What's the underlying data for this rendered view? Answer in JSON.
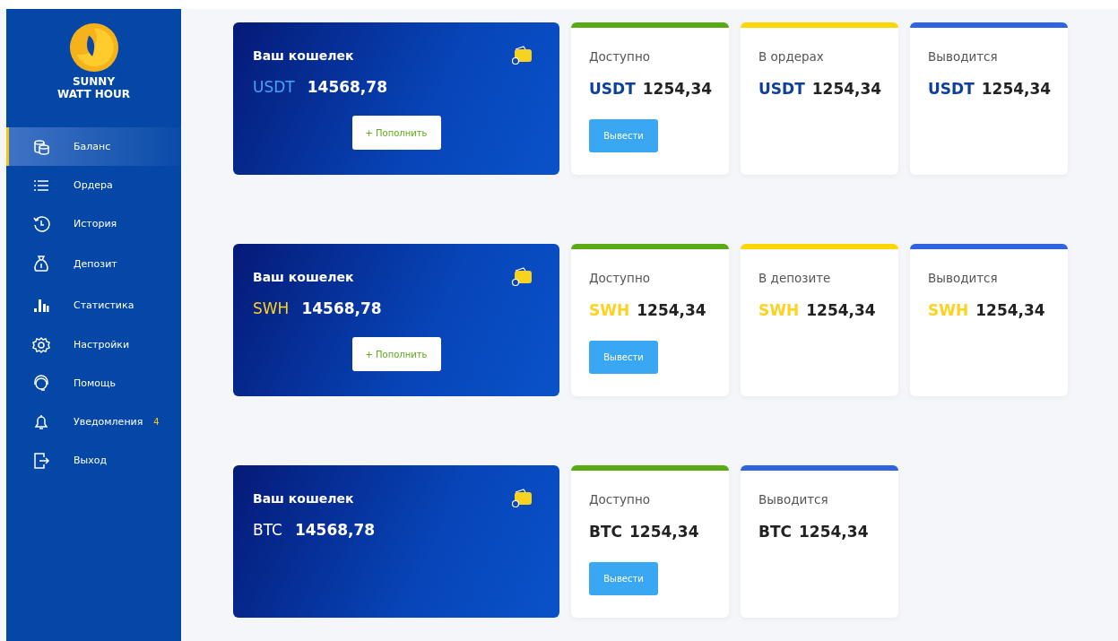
{
  "brand": {
    "line1": "SUNNY",
    "line2": "WATT HOUR"
  },
  "sidebar": {
    "items": [
      {
        "label": "Баланс",
        "selected": true
      },
      {
        "label": "Ордера",
        "selected": false
      },
      {
        "label": "История",
        "selected": false
      },
      {
        "label": "Депозит",
        "selected": false
      },
      {
        "label": "Статистика",
        "selected": false
      },
      {
        "label": "Настройки",
        "selected": false
      },
      {
        "label": "Помощь",
        "selected": false
      },
      {
        "label": "Уведомления",
        "selected": false,
        "badge": "4"
      },
      {
        "label": "Выход",
        "selected": false
      }
    ]
  },
  "sections": [
    {
      "wallet": {
        "title": "Ваш кошелек",
        "code": "USDT",
        "color": "#42a5f5",
        "amount": "14568,78",
        "button": "+ Пополнить"
      },
      "cards": [
        {
          "label": "Доступно",
          "color": "#5aaa16",
          "currency": {
            "code": "USDT",
            "color": "#0d3f9c"
          },
          "amount": "1254,34",
          "button": "Вывести"
        },
        {
          "label": "В ордерах",
          "color": "#ffd600",
          "currency": {
            "code": "USDT",
            "color": "#0d3f9c"
          },
          "amount": "1254,34"
        },
        {
          "label": "Выводится",
          "color": "#2f63e0",
          "currency": {
            "code": "USDT",
            "color": "#0d3f9c"
          },
          "amount": "1254,34"
        }
      ]
    },
    {
      "wallet": {
        "title": "Ваш кошелек",
        "code": "SWH",
        "color": "#ffd21f",
        "amount": "14568,78",
        "button": "+ Пополнить"
      },
      "cards": [
        {
          "label": "Доступно",
          "color": "#5aaa16",
          "currency": {
            "code": "SWH",
            "color": "#ffd21f"
          },
          "amount": "1254,34",
          "button": "Вывести"
        },
        {
          "label": "В депозите",
          "color": "#ffd600",
          "currency": {
            "code": "SWH",
            "color": "#ffd21f"
          },
          "amount": "1254,34"
        },
        {
          "label": "Выводится",
          "color": "#2f63e0",
          "currency": {
            "code": "SWH",
            "color": "#ffd21f"
          },
          "amount": "1254,34"
        }
      ]
    },
    {
      "wallet": {
        "title": "Ваш кошелек",
        "code": "BTC",
        "color": "#ffffff",
        "amount": "14568,78"
      },
      "cards": [
        {
          "label": "Доступно",
          "color": "#5aaa16",
          "currency": {
            "code": "BTC",
            "color": "#222222"
          },
          "amount": "1254,34",
          "button": "Вывести"
        },
        {
          "label": "Выводится",
          "color": "#2f63e0",
          "currency": {
            "code": "BTC",
            "color": "#222222"
          },
          "amount": "1254,34"
        }
      ]
    }
  ]
}
